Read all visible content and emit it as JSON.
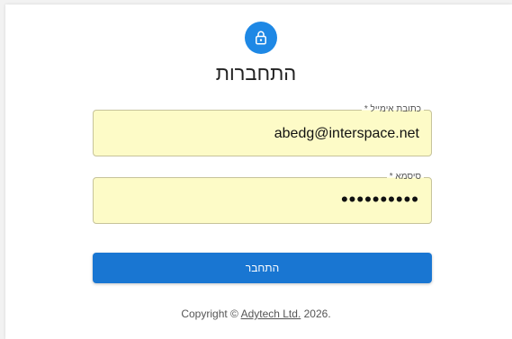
{
  "page": {
    "title": "התחברות"
  },
  "icons": {
    "badge": "lock-icon",
    "badge_color": "#1e88e5"
  },
  "form": {
    "email": {
      "label": "כתובת אימייל *",
      "value": "abedg@interspace.net"
    },
    "password": {
      "label": "סיסמא *",
      "masked_value": "••••••••••"
    },
    "submit_label": "התחבר",
    "field_background": "#fdfbc7",
    "button_color": "#1976d2"
  },
  "footer": {
    "prefix": "Copyright ©",
    "company": "Adytech Ltd.",
    "year": "2026."
  }
}
